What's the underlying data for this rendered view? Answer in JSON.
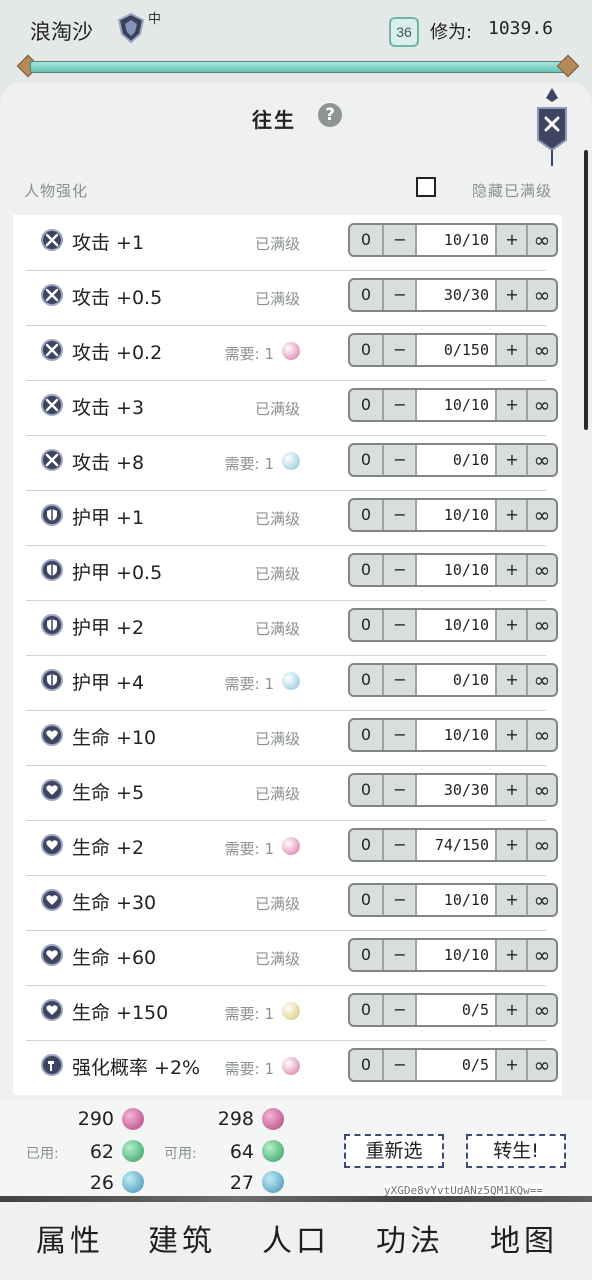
{
  "header": {
    "player_name": "浪淘沙",
    "rank_sub": "中",
    "level": "36",
    "cultivation_label": "修为:",
    "cultivation_value": "1039.6",
    "progress": 1.0
  },
  "panel": {
    "title": "往生",
    "section_label": "人物强化",
    "hide_maxed_label": "隐藏已满级"
  },
  "colors": {
    "orb_pink": "#d86fa5",
    "orb_blue": "#87c3d6",
    "orb_gold": "#d8c06a",
    "orb_green": "#56c48a",
    "accent_teal": "#6fc2b2"
  },
  "upgrades": [
    {
      "icon": "sword-icon",
      "name": "攻击 +1",
      "status": "已满级",
      "cost": "",
      "orb": "",
      "min": "0",
      "minus": "−",
      "value": "10/10",
      "plus": "+",
      "max": "∞"
    },
    {
      "icon": "sword-icon",
      "name": "攻击 +0.5",
      "status": "已满级",
      "cost": "",
      "orb": "",
      "min": "0",
      "minus": "−",
      "value": "30/30",
      "plus": "+",
      "max": "∞"
    },
    {
      "icon": "sword-icon",
      "name": "攻击 +0.2",
      "status": "需要: 1",
      "cost": "1",
      "orb": "pink",
      "min": "0",
      "minus": "−",
      "value": "0/150",
      "plus": "+",
      "max": "∞"
    },
    {
      "icon": "sword-icon",
      "name": "攻击 +3",
      "status": "已满级",
      "cost": "",
      "orb": "",
      "min": "0",
      "minus": "−",
      "value": "10/10",
      "plus": "+",
      "max": "∞"
    },
    {
      "icon": "sword-icon",
      "name": "攻击 +8",
      "status": "需要: 1",
      "cost": "1",
      "orb": "blue",
      "min": "0",
      "minus": "−",
      "value": "0/10",
      "plus": "+",
      "max": "∞"
    },
    {
      "icon": "shield-icon",
      "name": "护甲 +1",
      "status": "已满级",
      "cost": "",
      "orb": "",
      "min": "0",
      "minus": "−",
      "value": "10/10",
      "plus": "+",
      "max": "∞"
    },
    {
      "icon": "shield-icon",
      "name": "护甲 +0.5",
      "status": "已满级",
      "cost": "",
      "orb": "",
      "min": "0",
      "minus": "−",
      "value": "10/10",
      "plus": "+",
      "max": "∞"
    },
    {
      "icon": "shield-icon",
      "name": "护甲 +2",
      "status": "已满级",
      "cost": "",
      "orb": "",
      "min": "0",
      "minus": "−",
      "value": "10/10",
      "plus": "+",
      "max": "∞"
    },
    {
      "icon": "shield-icon",
      "name": "护甲 +4",
      "status": "需要: 1",
      "cost": "1",
      "orb": "blue",
      "min": "0",
      "minus": "−",
      "value": "0/10",
      "plus": "+",
      "max": "∞"
    },
    {
      "icon": "heart-icon",
      "name": "生命 +10",
      "status": "已满级",
      "cost": "",
      "orb": "",
      "min": "0",
      "minus": "−",
      "value": "10/10",
      "plus": "+",
      "max": "∞"
    },
    {
      "icon": "heart-icon",
      "name": "生命 +5",
      "status": "已满级",
      "cost": "",
      "orb": "",
      "min": "0",
      "minus": "−",
      "value": "30/30",
      "plus": "+",
      "max": "∞"
    },
    {
      "icon": "heart-icon",
      "name": "生命 +2",
      "status": "需要: 1",
      "cost": "1",
      "orb": "pink",
      "min": "0",
      "minus": "−",
      "value": "74/150",
      "plus": "+",
      "max": "∞"
    },
    {
      "icon": "heart-icon",
      "name": "生命 +30",
      "status": "已满级",
      "cost": "",
      "orb": "",
      "min": "0",
      "minus": "−",
      "value": "10/10",
      "plus": "+",
      "max": "∞"
    },
    {
      "icon": "heart-icon",
      "name": "生命 +60",
      "status": "已满级",
      "cost": "",
      "orb": "",
      "min": "0",
      "minus": "−",
      "value": "10/10",
      "plus": "+",
      "max": "∞"
    },
    {
      "icon": "heart-icon",
      "name": "生命 +150",
      "status": "需要: 1",
      "cost": "1",
      "orb": "gold",
      "min": "0",
      "minus": "−",
      "value": "0/5",
      "plus": "+",
      "max": "∞"
    },
    {
      "icon": "hammer-icon",
      "name": "强化概率 +2%",
      "status": "需要: 1",
      "cost": "1",
      "orb": "pink",
      "min": "0",
      "minus": "−",
      "value": "0/5",
      "plus": "+",
      "max": "∞"
    }
  ],
  "resources": {
    "used_label": "已用:",
    "available_label": "可用:",
    "used": [
      "290",
      "62",
      "26"
    ],
    "available": [
      "298",
      "64",
      "27"
    ],
    "orb_kinds": [
      "pink",
      "green",
      "blue"
    ]
  },
  "actions": {
    "reselect_label": "重新选",
    "rebirth_label": "转生!"
  },
  "seed": "yXGDe8vYvtUdANz5QM1KQw==",
  "nav": {
    "items": [
      "属性",
      "建筑",
      "人口",
      "功法",
      "地图"
    ]
  }
}
